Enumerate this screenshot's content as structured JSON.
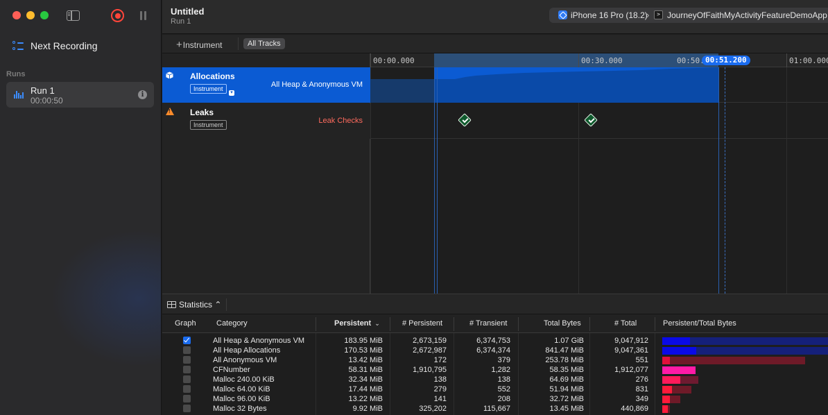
{
  "sidebar": {
    "next_recording": "Next Recording",
    "runs_label": "Runs",
    "run": {
      "name": "Run 1",
      "duration": "00:00:50"
    }
  },
  "header": {
    "title": "Untitled",
    "subtitle": "Run 1",
    "device": "iPhone 16 Pro (18.2)",
    "app": "JourneyOfFaithMyActivityFeatureDemoApp"
  },
  "toolbar": {
    "add_instrument": "Instrument",
    "all_tracks": "All Tracks"
  },
  "timeline": {
    "ticks": [
      "00:00.000",
      "00:30.000",
      "00:50.",
      "01:00.000"
    ],
    "playhead": "00:51.200"
  },
  "tracks": [
    {
      "name": "Allocations",
      "badge": "Instrument",
      "detail": "All Heap & Anonymous VM",
      "icon": "cube-icon"
    },
    {
      "name": "Leaks",
      "badge": "Instrument",
      "detail": "Leak Checks",
      "icon": "warning-icon"
    }
  ],
  "statistics": {
    "label": "Statistics",
    "columns": [
      "Graph",
      "Category",
      "Persistent",
      "# Persistent",
      "# Transient",
      "Total Bytes",
      "# Total",
      "Persistent/Total Bytes"
    ],
    "rows": [
      {
        "checked": true,
        "category": "All Heap & Anonymous VM",
        "persistent": "183.95 MiB",
        "n_persistent": "2,673,159",
        "n_transient": "6,374,753",
        "total_bytes": "1.07 GiB",
        "n_total": "9,047,912",
        "ratio": 0.168,
        "bar_total": 1.0,
        "color": "#0a0ae6",
        "dim": "#15207a"
      },
      {
        "checked": false,
        "category": "All Heap Allocations",
        "persistent": "170.53 MiB",
        "n_persistent": "2,672,987",
        "n_transient": "6,374,374",
        "total_bytes": "841.47 MiB",
        "n_total": "9,047,361",
        "ratio": 0.203,
        "bar_total": 1.0,
        "color": "#0a0ae6",
        "dim": "#15207a"
      },
      {
        "checked": false,
        "category": "All Anonymous VM",
        "persistent": "13.42 MiB",
        "n_persistent": "172",
        "n_transient": "379",
        "total_bytes": "253.78 MiB",
        "n_total": "551",
        "ratio": 0.053,
        "bar_total": 0.86,
        "color": "#e0103a",
        "dim": "#6e1a28"
      },
      {
        "checked": false,
        "category": "CFNumber",
        "persistent": "58.31 MiB",
        "n_persistent": "1,910,795",
        "n_transient": "1,282",
        "total_bytes": "58.35 MiB",
        "n_total": "1,912,077",
        "ratio": 0.999,
        "bar_total": 0.198,
        "color": "#ff1aa6",
        "dim": "#6e1a4a"
      },
      {
        "checked": false,
        "category": "Malloc 240.00 KiB",
        "persistent": "32.34 MiB",
        "n_persistent": "138",
        "n_transient": "138",
        "total_bytes": "64.69 MiB",
        "n_total": "276",
        "ratio": 0.5,
        "bar_total": 0.218,
        "color": "#ff1a5a",
        "dim": "#6e1a30"
      },
      {
        "checked": false,
        "category": "Malloc 64.00 KiB",
        "persistent": "17.44 MiB",
        "n_persistent": "279",
        "n_transient": "552",
        "total_bytes": "51.94 MiB",
        "n_total": "831",
        "ratio": 0.336,
        "bar_total": 0.175,
        "color": "#ff1a3a",
        "dim": "#6e1a28"
      },
      {
        "checked": false,
        "category": "Malloc 96.00 KiB",
        "persistent": "13.22 MiB",
        "n_persistent": "141",
        "n_transient": "208",
        "total_bytes": "32.72 MiB",
        "n_total": "349",
        "ratio": 0.404,
        "bar_total": 0.11,
        "color": "#ff1a3a",
        "dim": "#6e1a28"
      },
      {
        "checked": false,
        "category": "Malloc 32 Bytes",
        "persistent": "9.92 MiB",
        "n_persistent": "325,202",
        "n_transient": "115,667",
        "total_bytes": "13.45 MiB",
        "n_total": "440,869",
        "ratio": 0.737,
        "bar_total": 0.045,
        "color": "#ff1a3a",
        "dim": "#6e1a28"
      }
    ]
  }
}
